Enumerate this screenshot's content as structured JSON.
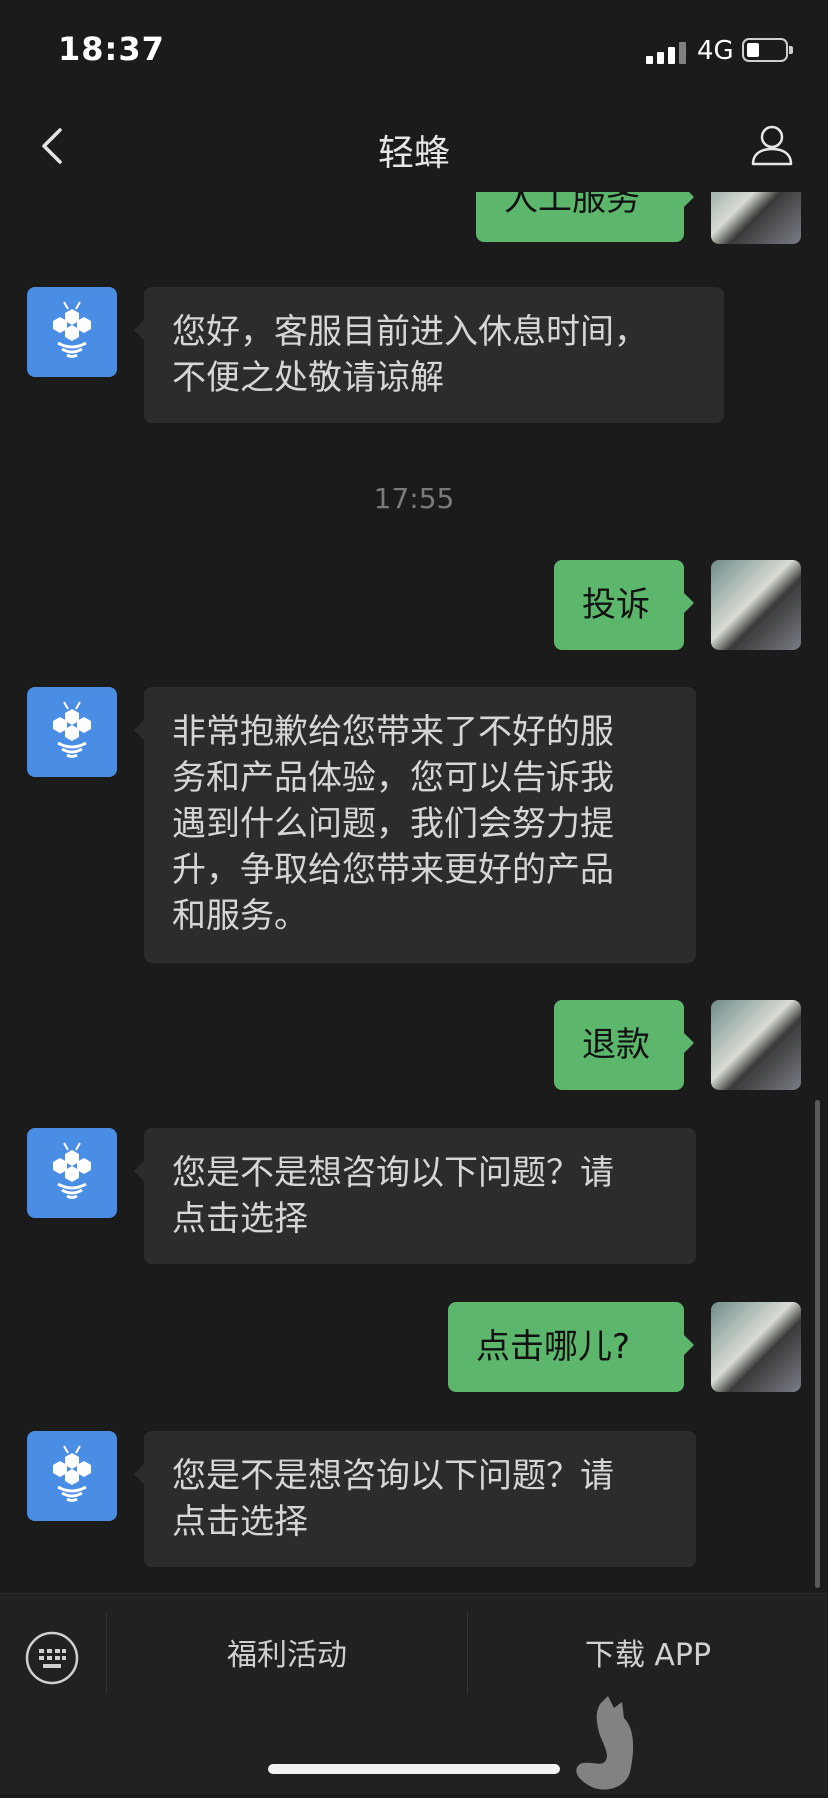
{
  "status_bar": {
    "time": "18:37",
    "network": "4G",
    "signal_bars": 4,
    "battery_level": 0.3
  },
  "nav": {
    "title": "轻蜂"
  },
  "messages": [
    {
      "from": "user",
      "text": "人工服务"
    },
    {
      "from": "bot",
      "lines": [
        "您好，客服目前进入休息时间，",
        "不便之处敬请谅解"
      ]
    },
    {
      "timestamp": "17:55"
    },
    {
      "from": "user",
      "text": "投诉"
    },
    {
      "from": "bot",
      "lines": [
        "非常抱歉给您带来了不好的服",
        "务和产品体验，您可以告诉我",
        "遇到什么问题，我们会努力提",
        "升，争取给您带来更好的产品",
        "和服务。"
      ]
    },
    {
      "from": "user",
      "text": "退款"
    },
    {
      "from": "bot",
      "lines": [
        "您是不是想咨询以下问题？请",
        "点击选择"
      ]
    },
    {
      "from": "user",
      "text": "点击哪儿?"
    },
    {
      "from": "bot",
      "lines": [
        "您是不是想咨询以下问题？请",
        "点击选择"
      ]
    }
  ],
  "bottom_menu": {
    "item1": "福利活动",
    "item2": "下载 APP"
  },
  "icons": {
    "back": "chevron-left-icon",
    "profile": "person-icon",
    "keyboard": "keyboard-icon",
    "bot_avatar": "bee-logo-icon"
  },
  "colors": {
    "user_bubble": "#5cb76c",
    "bot_bubble": "#2c2c2c",
    "bot_avatar_bg": "#4a8de5",
    "background": "#1b1b1b"
  }
}
